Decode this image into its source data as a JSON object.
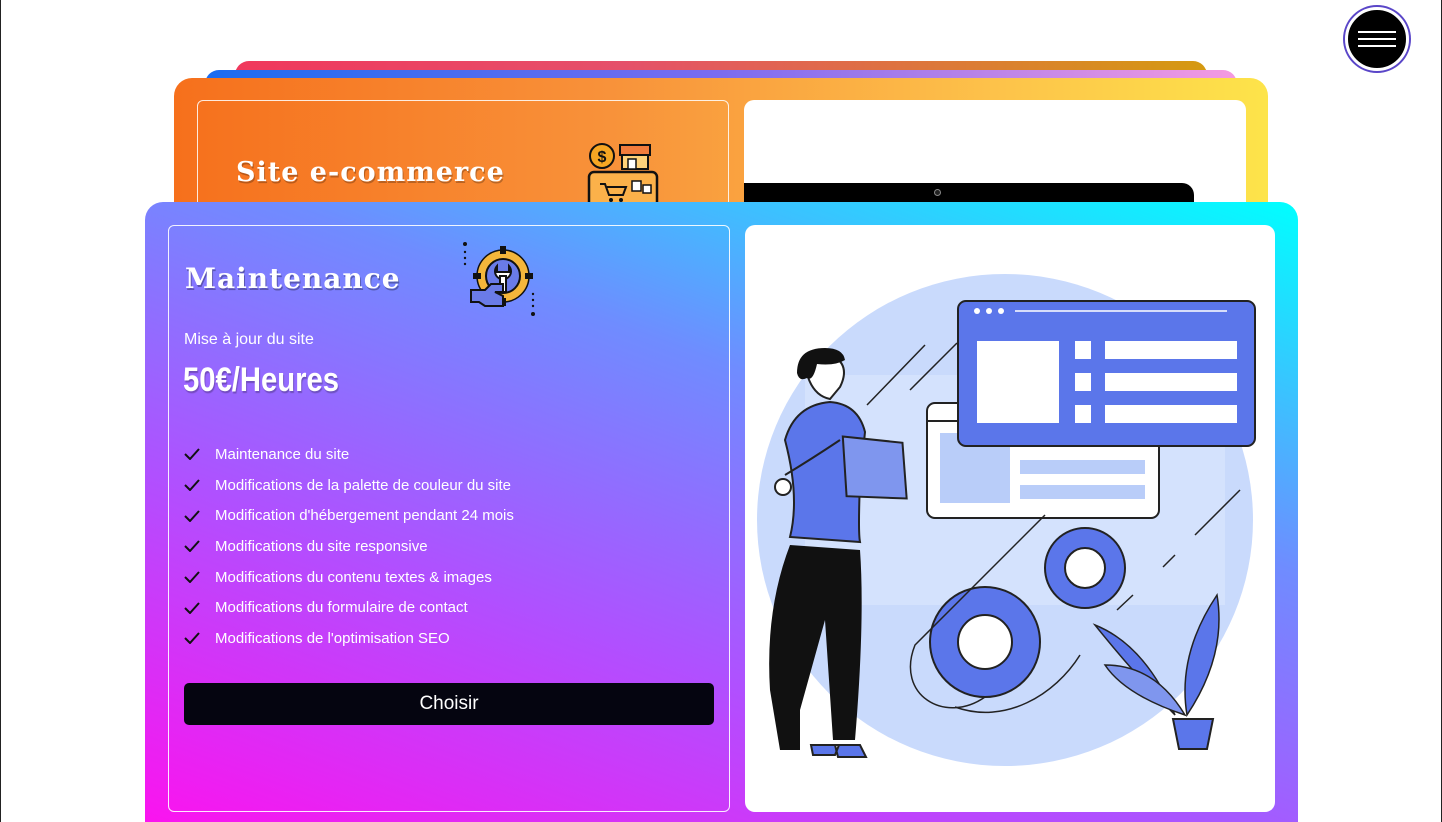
{
  "nav": {
    "menu_icon": "hamburger-menu-icon"
  },
  "cards": [
    {
      "title": "Site e-commerce",
      "icon": "online-shop-icon",
      "accent_gradient": [
        "#f6701c",
        "#fde44a"
      ]
    },
    {
      "title": "Maintenance",
      "icon": "maintenance-gear-wrench-icon",
      "subtitle": "Mise à jour du site",
      "price": "50€/Heures",
      "features": [
        "Maintenance du site",
        "Modifications de la palette de couleur du site",
        "Modification d'hébergement pendant 24 mois",
        "Modifications du site responsive",
        "Modifications du contenu textes & images",
        "Modifications du formulaire de contact",
        "Modifications de l'optimisation SEO"
      ],
      "button_label": "Choisir",
      "accent_gradient": [
        "#ff10ee",
        "#00ffff"
      ],
      "illustration": "person-with-tablet-gears-website-illustration"
    }
  ],
  "colors": {
    "illustration_blue": "#5b76ea",
    "illustration_light": "#c9dafc",
    "button_bg": "#050510"
  }
}
